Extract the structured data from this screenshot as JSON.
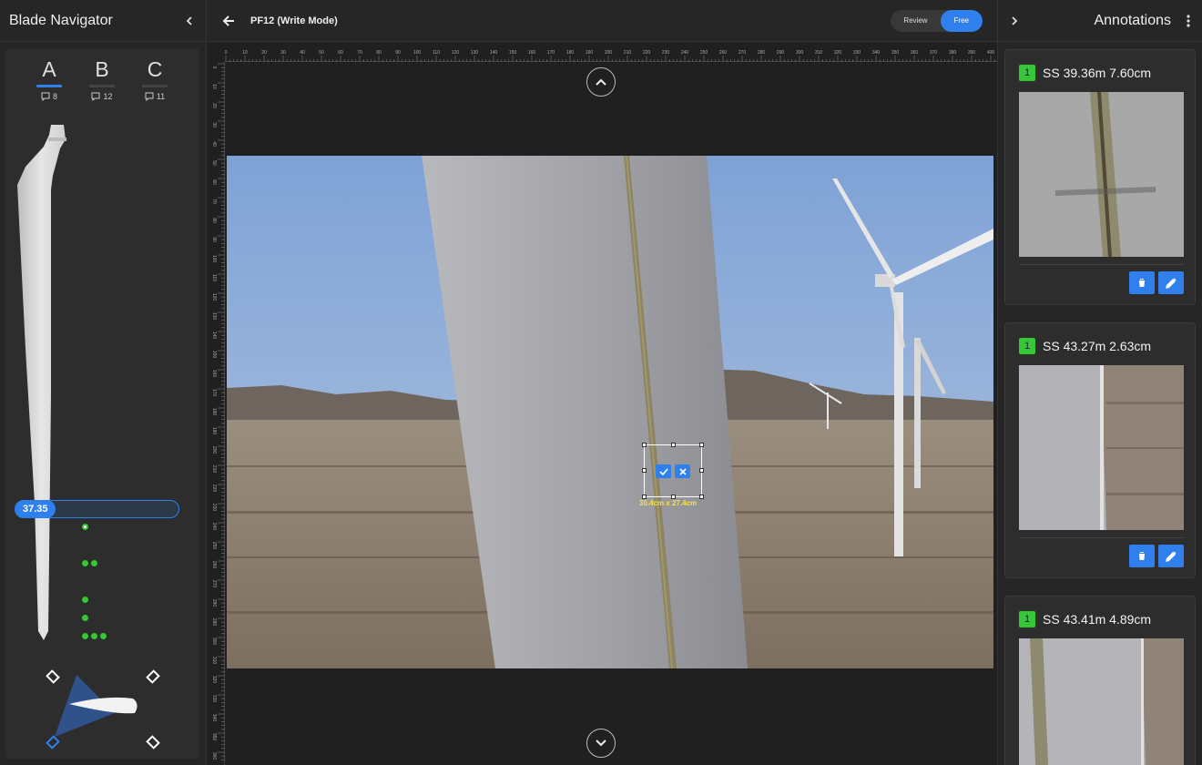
{
  "left_panel": {
    "title": "Blade Navigator",
    "blades": [
      {
        "letter": "A",
        "count": "8",
        "active": true
      },
      {
        "letter": "B",
        "count": "12",
        "active": false
      },
      {
        "letter": "C",
        "count": "11",
        "active": false
      }
    ],
    "position_value": "37.35"
  },
  "main": {
    "title": "PF12 (Write Mode)",
    "mode_toggle": {
      "options": [
        "Review",
        "Free"
      ],
      "selected": "Free"
    },
    "ruler_top_ticks": [
      "0",
      "10",
      "20",
      "30",
      "40",
      "50",
      "60",
      "70",
      "80",
      "90",
      "100",
      "110",
      "120",
      "130",
      "140",
      "150",
      "160",
      "170",
      "180",
      "190",
      "200",
      "210",
      "220",
      "230",
      "240",
      "250",
      "260",
      "270",
      "280",
      "290",
      "300",
      "310",
      "320",
      "330",
      "340",
      "350",
      "360",
      "370",
      "380",
      "390",
      "400"
    ],
    "ruler_left_ticks": [
      "0",
      "10",
      "20",
      "30",
      "40",
      "50",
      "60",
      "70",
      "80",
      "90",
      "100",
      "110",
      "120",
      "130",
      "140",
      "150",
      "160",
      "170",
      "180",
      "190",
      "200",
      "210",
      "220",
      "230",
      "240",
      "250",
      "260",
      "270",
      "280",
      "290",
      "300",
      "310",
      "320",
      "330",
      "340",
      "350",
      "360"
    ],
    "selection_dimensions": "30.4cm x 27.4cm"
  },
  "right_panel": {
    "title": "Annotations",
    "annotations": [
      {
        "badge": "1",
        "label": "SS 39.36m 7.60cm"
      },
      {
        "badge": "1",
        "label": "SS 43.27m 2.63cm"
      },
      {
        "badge": "1",
        "label": "SS 43.41m 4.89cm"
      }
    ]
  },
  "colors": {
    "accent": "#2f80ed",
    "badge": "#35c735",
    "dimension_text": "#f5e14a"
  }
}
